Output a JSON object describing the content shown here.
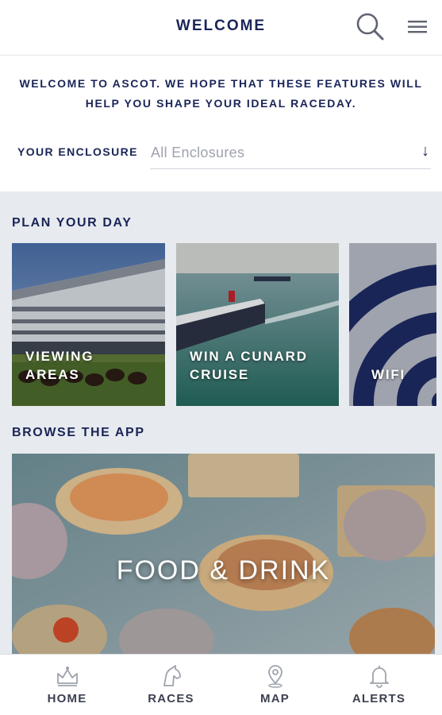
{
  "header": {
    "title": "WELCOME",
    "search_icon": "search-icon",
    "menu_icon": "hamburger-menu-icon"
  },
  "intro": {
    "text": "WELCOME TO ASCOT. WE HOPE THAT THESE FEATURES WILL HELP YOU SHAPE YOUR IDEAL RACEDAY.",
    "enclosure_label": "YOUR ENCLOSURE",
    "enclosure_value": "All Enclosures",
    "enclosure_arrow": "↓"
  },
  "plan": {
    "title": "PLAN YOUR DAY",
    "cards": [
      {
        "label_line1": "VIEWING",
        "label_line2": "AREAS"
      },
      {
        "label_line1": "WIN A CUNARD",
        "label_line2": "CRUISE"
      },
      {
        "label_line1": "",
        "label_line2": "WIFI"
      }
    ]
  },
  "browse": {
    "title": "BROWSE THE APP",
    "feature_label": "FOOD & DRINK"
  },
  "bottom_nav": {
    "items": [
      {
        "label": "HOME",
        "icon": "crown-icon"
      },
      {
        "label": "RACES",
        "icon": "horse-head-icon"
      },
      {
        "label": "MAP",
        "icon": "map-pin-icon"
      },
      {
        "label": "ALERTS",
        "icon": "bell-icon"
      }
    ]
  },
  "colors": {
    "brand_navy": "#1a2557",
    "section_bg": "#e7eaef",
    "muted_text": "#9ea3ad"
  }
}
